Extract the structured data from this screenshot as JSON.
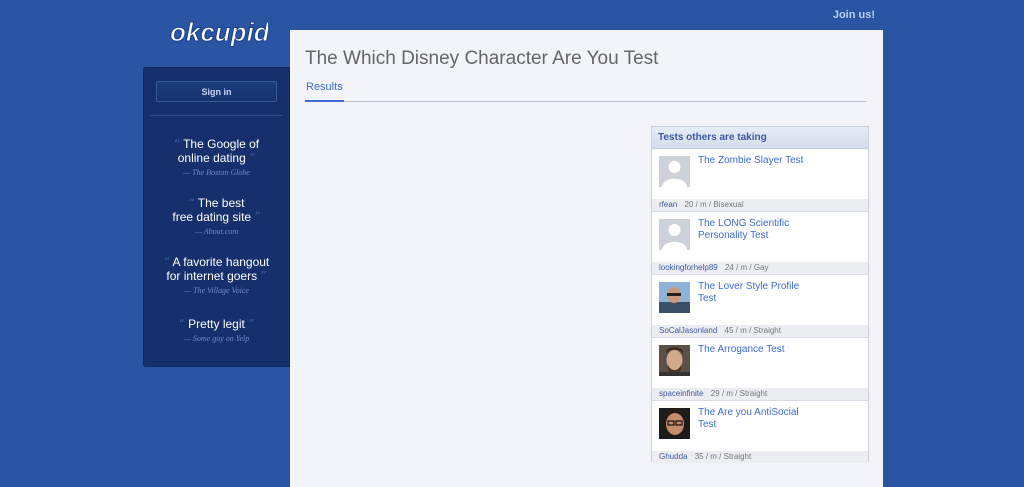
{
  "header": {
    "logo_text": "okcupid",
    "join_label": "Join us!"
  },
  "sidebar": {
    "signin_label": "Sign in",
    "quotes": [
      {
        "lines": [
          "The Google of",
          "online dating"
        ],
        "source": "— The Boston Globe"
      },
      {
        "lines": [
          "The best",
          "free dating site"
        ],
        "source": "— About.com"
      },
      {
        "lines": [
          "A favorite hangout",
          "for internet goers"
        ],
        "source": "— The Village Voice"
      },
      {
        "lines": [
          "Pretty legit",
          ""
        ],
        "source": "— Some guy on Yelp"
      }
    ]
  },
  "main": {
    "title": "The Which Disney Character Are You Test",
    "tabs": [
      {
        "label": "Results"
      }
    ]
  },
  "box": {
    "heading": "Tests others are taking",
    "items": [
      {
        "test": "The Zombie Slayer Test",
        "user": "rfean",
        "info": "20 / m / Bisexual",
        "avatar": "placeholder"
      },
      {
        "test": "The LONG Scientific Personality Test",
        "user": "lookingforhelp89",
        "info": "24 / m / Gay",
        "avatar": "placeholder"
      },
      {
        "test": "The Lover Style Profile Test",
        "user": "SoCalJasonland",
        "info": "45 / m / Straight",
        "avatar": "photo"
      },
      {
        "test": "The Arrogance Test",
        "user": "spaceinfinite",
        "info": "29 / m / Straight",
        "avatar": "photo"
      },
      {
        "test": "The Are you AntiSocial Test",
        "user": "Ghudda",
        "info": "35 / m / Straight",
        "avatar": "photo"
      }
    ]
  },
  "colors": {
    "background": "#2a55a3",
    "sidebar": "#15306c",
    "link": "#3d6bd6"
  }
}
